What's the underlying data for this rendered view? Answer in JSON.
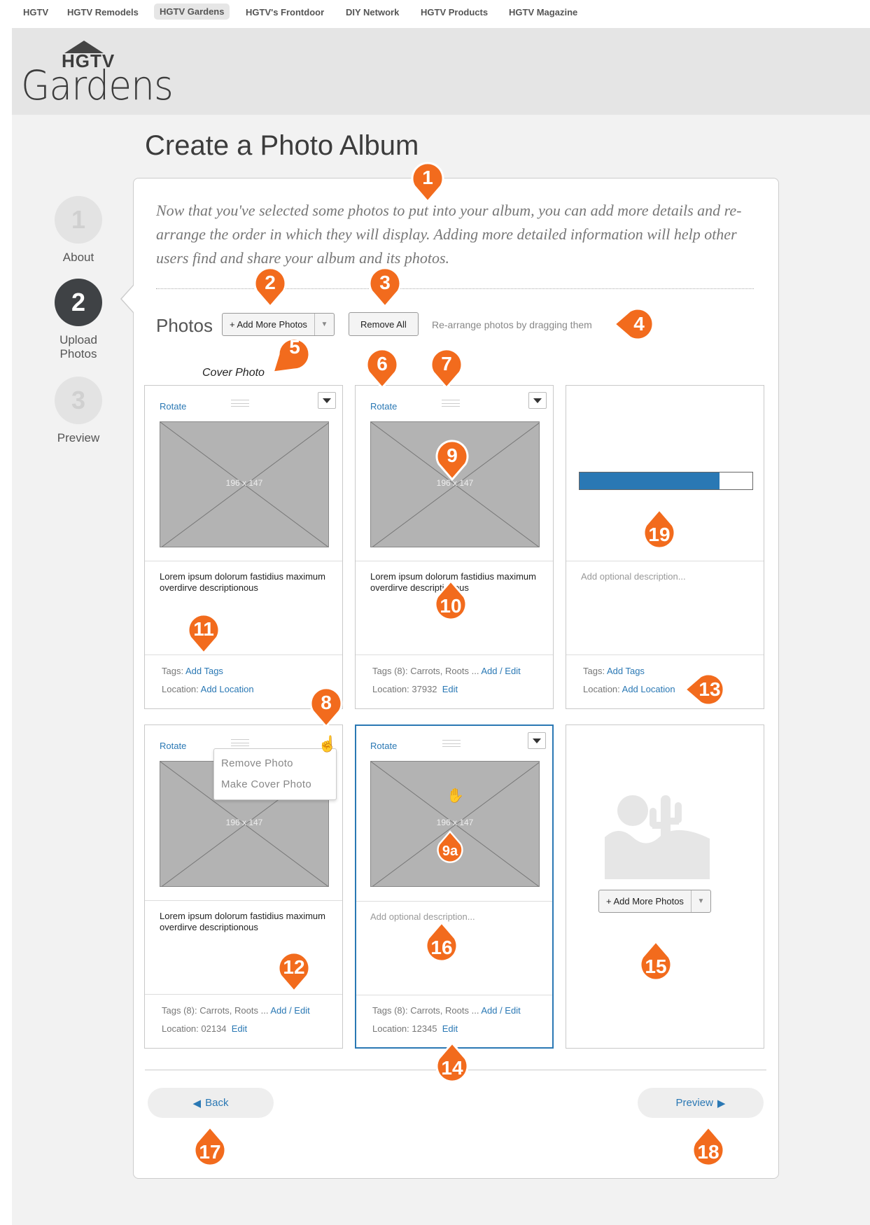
{
  "topnav": {
    "items": [
      "HGTV",
      "HGTV Remodels",
      "HGTV Gardens",
      "HGTV's Frontdoor",
      "DIY Network",
      "HGTV Products",
      "HGTV Magazine"
    ],
    "active_index": 2
  },
  "logo": {
    "brand": "HGTV",
    "name": "Gardens"
  },
  "page_title": "Create a Photo Album",
  "steps": [
    {
      "number": "1",
      "label": "About",
      "state": "inactive"
    },
    {
      "number": "2",
      "label": "Upload Photos",
      "state": "active"
    },
    {
      "number": "3",
      "label": "Preview",
      "state": "inactive"
    }
  ],
  "intro_text": "Now that you've selected some photos to put into your album, you can add more details and re-arrange the order in which they will display. Adding more detailed information will help other users find and share your album and its photos.",
  "toolbar": {
    "photos_label": "Photos",
    "add_more_label": "+ Add More Photos",
    "remove_all_label": "Remove All",
    "rearrange_hint": "Re-arrange photos by dragging them"
  },
  "cover_label": "Cover Photo",
  "cards": [
    {
      "rotate": "Rotate",
      "dims": "196 x 147",
      "description": "Lorem ipsum dolorum fastidius maximum overdirve descriptionous",
      "tags_prefix": "Tags: ",
      "tags_value": "",
      "tags_link": "Add Tags",
      "location_prefix": "Location: ",
      "location_value": "",
      "location_link": "Add Location"
    },
    {
      "rotate": "Rotate",
      "dims": "196 x 147",
      "description": "Lorem ipsum dolorum fastidius maximum overdirve descriptionous",
      "tags_prefix": "Tags (8): ",
      "tags_value": "Carrots, Roots ... ",
      "tags_link": "Add / Edit",
      "location_prefix": "Location: ",
      "location_value": "37932  ",
      "location_link": "Edit"
    },
    {
      "description_placeholder": "Add optional description...",
      "upload_progress": 0.81,
      "tags_prefix": "Tags: ",
      "tags_value": "",
      "tags_link": "Add Tags",
      "location_prefix": "Location: ",
      "location_value": "",
      "location_link": "Add Location"
    },
    {
      "rotate": "Rotate",
      "dims": "196 x 147",
      "description": "Lorem ipsum dolorum fastidius maximum overdirve descriptionous",
      "tags_prefix": "Tags (8): ",
      "tags_value": "Carrots, Roots ... ",
      "tags_link": "Add / Edit",
      "location_prefix": "Location: ",
      "location_value": "02134  ",
      "location_link": "Edit"
    },
    {
      "rotate": "Rotate",
      "dims": "196 x 147",
      "description_placeholder": "Add optional description...",
      "tags_prefix": "Tags (8): ",
      "tags_value": "Carrots, Roots ... ",
      "tags_link": "Add / Edit",
      "location_prefix": "Location: ",
      "location_value": "12345  ",
      "location_link": "Edit"
    },
    {
      "add_more_label": "+ Add More Photos"
    }
  ],
  "dropdown_menu": {
    "options": [
      "Remove Photo",
      "Make Cover Photo"
    ]
  },
  "back_label": "Back",
  "preview_label": "Preview",
  "annotations": [
    "1",
    "2",
    "3",
    "4",
    "5",
    "6",
    "7",
    "8",
    "9",
    "9a",
    "10",
    "11",
    "12",
    "13",
    "14",
    "15",
    "16",
    "17",
    "18",
    "19"
  ],
  "colors": {
    "accent": "#2a78b4",
    "marker": "#f26b1d",
    "active_step": "#3f4245"
  }
}
